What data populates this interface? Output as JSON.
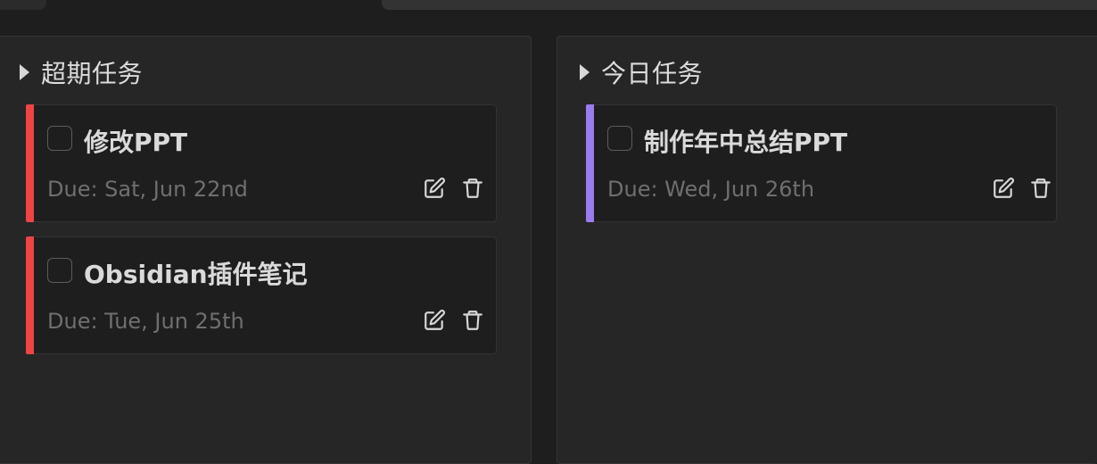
{
  "colors": {
    "overdue_accent": "#ef4444",
    "today_accent": "#9a7cf0"
  },
  "sections": {
    "overdue": {
      "title": "超期任务",
      "tasks": [
        {
          "title": "修改PPT",
          "due": "Due: Sat, Jun 22nd",
          "checked": false,
          "edit_icon": "edit-icon",
          "delete_icon": "trash-icon"
        },
        {
          "title": "Obsidian插件笔记",
          "due": "Due: Tue, Jun 25th",
          "checked": false,
          "edit_icon": "edit-icon",
          "delete_icon": "trash-icon"
        }
      ]
    },
    "today": {
      "title": "今日任务",
      "tasks": [
        {
          "title": "制作年中总结PPT",
          "due": "Due: Wed, Jun 26th",
          "checked": false,
          "edit_icon": "edit-icon",
          "delete_icon": "trash-icon"
        }
      ]
    }
  }
}
